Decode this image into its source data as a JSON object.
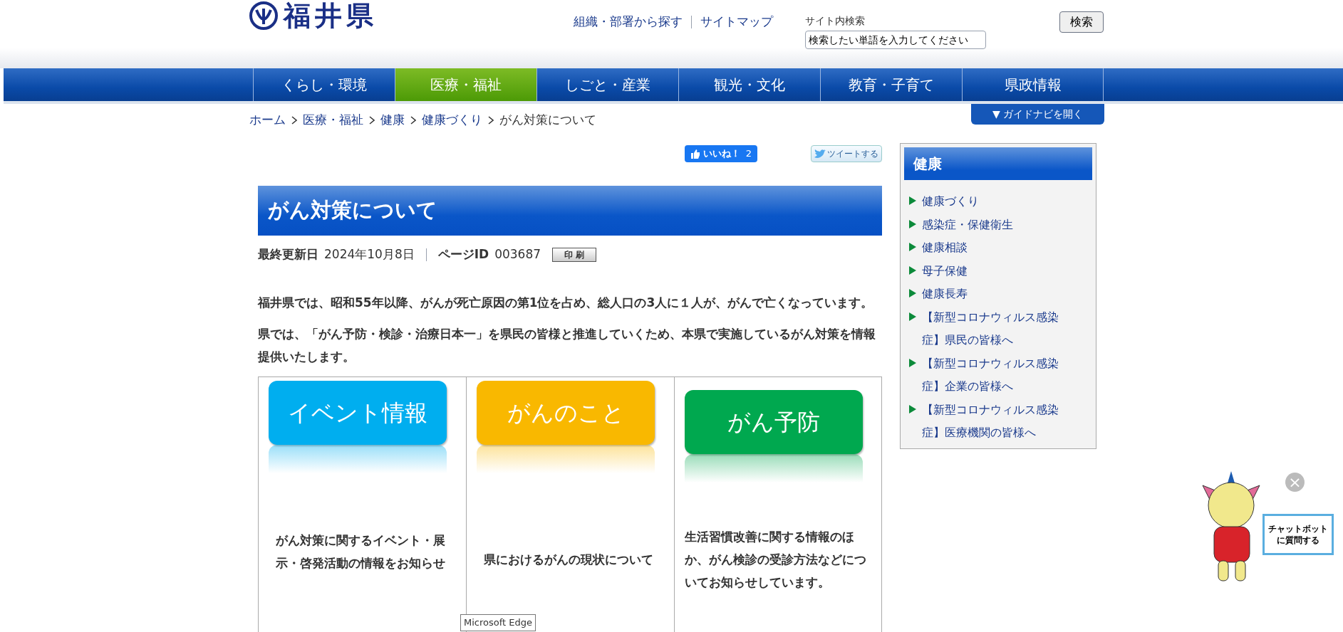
{
  "header": {
    "logo_text": "福井県",
    "links": [
      "組織・部署から探す",
      "サイトマップ"
    ],
    "search_label": "サイト内検索",
    "search_placeholder": "検索したい単語を入力してください",
    "search_button": "検索"
  },
  "nav": [
    {
      "label": "くらし・環境",
      "selected": false
    },
    {
      "label": "医療・福祉",
      "selected": true
    },
    {
      "label": "しごと・産業",
      "selected": false
    },
    {
      "label": "観光・文化",
      "selected": false
    },
    {
      "label": "教育・子育て",
      "selected": false
    },
    {
      "label": "県政情報",
      "selected": false
    }
  ],
  "guide_button": "▼ ガイドナビを開く",
  "breadcrumb": [
    {
      "label": "ホーム",
      "kind": "link"
    },
    {
      "label": "医療・福祉",
      "kind": "link"
    },
    {
      "label": "健康",
      "kind": "link"
    },
    {
      "label": "健康づくり",
      "kind": "link"
    },
    {
      "label": "がん対策について",
      "kind": "current"
    }
  ],
  "social": {
    "like": "いいね！",
    "like_count": "2",
    "tweet": "ツイートする"
  },
  "title": "がん対策について",
  "meta": {
    "updated_label": "最終更新日",
    "updated": "2024年10月8日",
    "page_id_label": "ページID",
    "page_id": "003687",
    "print": "印 刷"
  },
  "paragraphs": [
    "福井県では、昭和55年以降、がんが死亡原因の第1位を占め、総人口の3人に１人が、がんで亡くなっています。",
    "県では、「がん予防・検診・治療日本一」を県民の皆様と推進していくため、本県で実施しているがん対策を情報提供いたします。"
  ],
  "cards": [
    {
      "banner": "イベント情報",
      "color": "#00aeef",
      "text": "がん対策に関するイベント・展示・啓発活動の情報をお知らせ"
    },
    {
      "banner": "がんのこと",
      "color": "#f9b800",
      "text": "県におけるがんの現状について"
    },
    {
      "banner": "がん予防",
      "color": "#00a84f",
      "text": "生活習慣改善に関する情報のほか、がん検診の受診方法などについてお知らせしています。"
    }
  ],
  "sidebar": {
    "title": "健康",
    "items": [
      "健康づくり",
      "感染症・保健衛生",
      "健康相談",
      "母子保健",
      "健康長寿",
      "【新型コロナウィルス感染症】県民の皆様へ",
      "【新型コロナウィルス感染症】企業の皆様へ",
      "【新型コロナウィルス感染症】医療機関の皆様へ"
    ]
  },
  "chatbot": {
    "sign": "チャットボットに質問する",
    "close": "×"
  },
  "tooltip": "Microsoft Edge"
}
